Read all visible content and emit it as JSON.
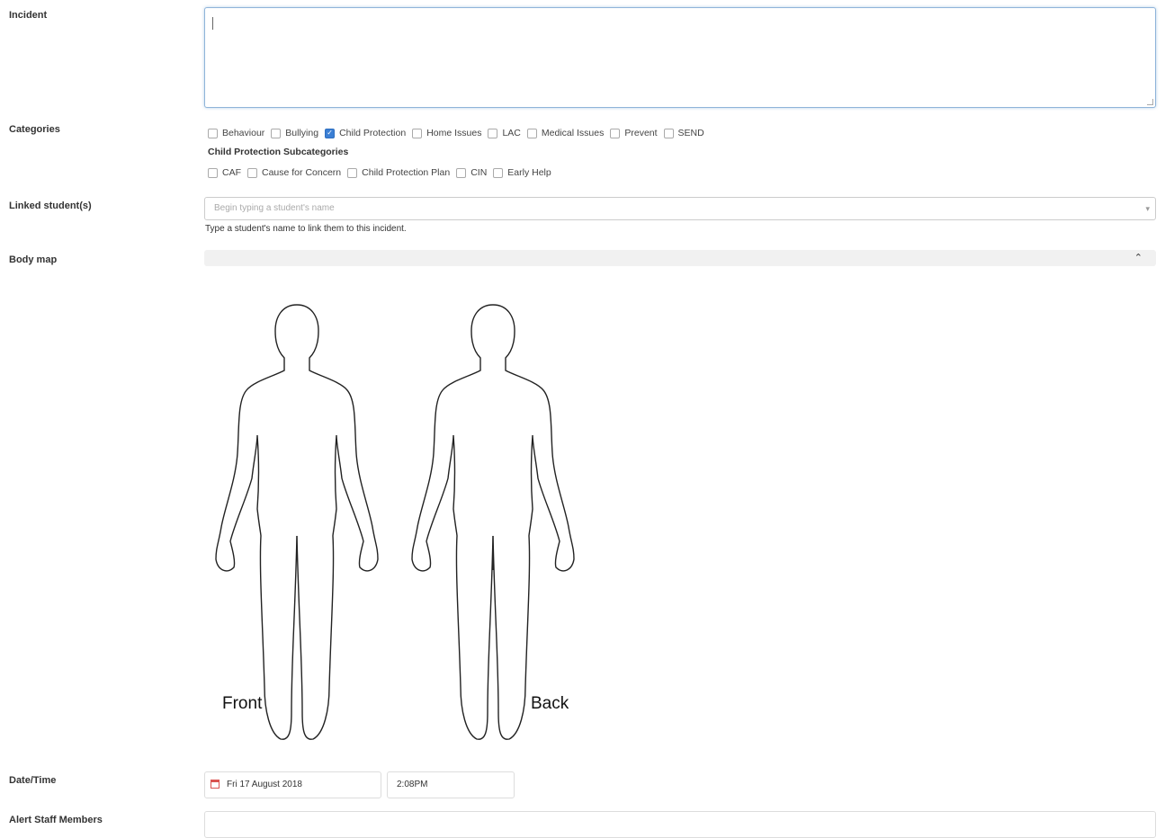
{
  "labels": {
    "incident": "Incident",
    "categories": "Categories",
    "linked_students": "Linked student(s)",
    "body_map": "Body map",
    "date_time": "Date/Time",
    "alert_staff": "Alert Staff Members"
  },
  "incident": {
    "value": ""
  },
  "categories": [
    {
      "label": "Behaviour",
      "checked": false
    },
    {
      "label": "Bullying",
      "checked": false
    },
    {
      "label": "Child Protection",
      "checked": true
    },
    {
      "label": "Home Issues",
      "checked": false
    },
    {
      "label": "LAC",
      "checked": false
    },
    {
      "label": "Medical Issues",
      "checked": false
    },
    {
      "label": "Prevent",
      "checked": false
    },
    {
      "label": "SEND",
      "checked": false
    }
  ],
  "subcategories": {
    "title": "Child Protection Subcategories",
    "items": [
      {
        "label": "CAF",
        "checked": false
      },
      {
        "label": "Cause for Concern",
        "checked": false
      },
      {
        "label": "Child Protection Plan",
        "checked": false
      },
      {
        "label": "CIN",
        "checked": false
      },
      {
        "label": "Early Help",
        "checked": false
      }
    ]
  },
  "linked_students": {
    "placeholder": "Begin typing a student's name",
    "help": "Type a student's name to link them to this incident."
  },
  "body_map": {
    "front_label": "Front",
    "back_label": "Back",
    "chevron": "⌃"
  },
  "date_time": {
    "date": "Fri 17 August 2018",
    "time": "2:08PM"
  },
  "icons": {
    "calendar": "calendar-icon",
    "chevron_up": "chevron-up-icon",
    "dropdown": "dropdown-arrow-icon"
  },
  "colors": {
    "checkbox_checked": "#3b7fd4",
    "focus_border": "#8fb4d9",
    "calendar": "#d9534f"
  }
}
